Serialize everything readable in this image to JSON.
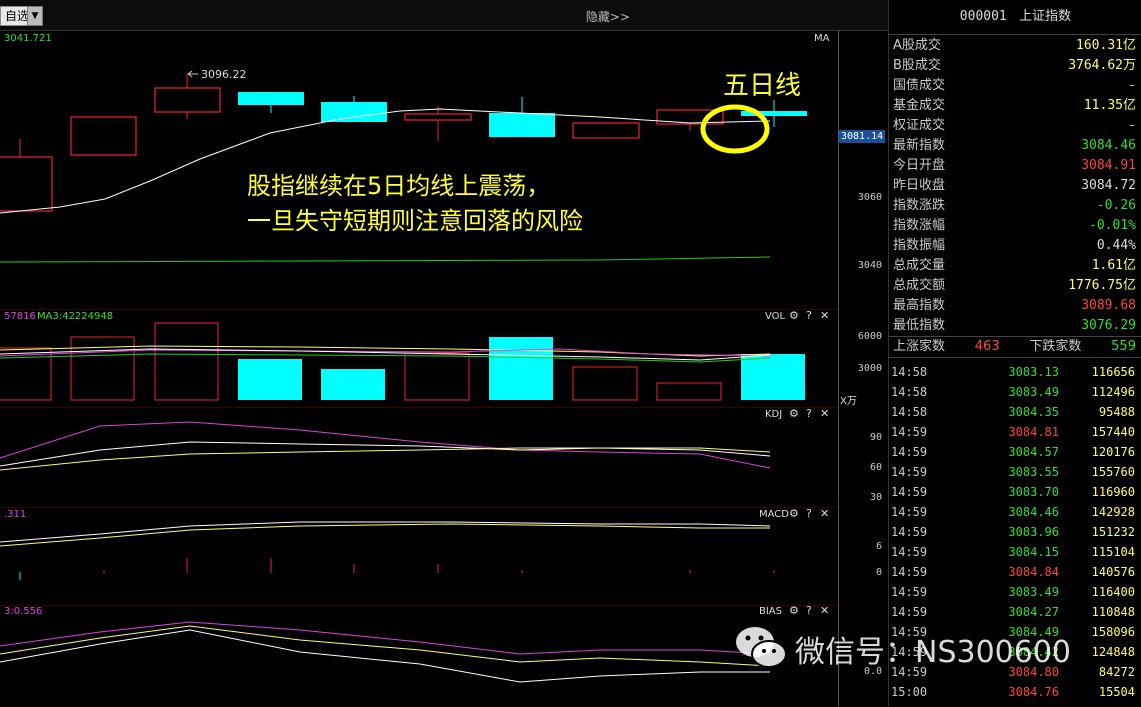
{
  "topbar": {
    "zixuan": "自选",
    "hide_label": "隐藏",
    "hide_icon": "double-chevron-right-icon"
  },
  "main_chart": {
    "top_left_value": "3041.721",
    "ma_label": "MA",
    "peak_label": "3096.22",
    "price_box": "3081.14",
    "axis_ticks": [
      "3060",
      "3040"
    ],
    "annotation_line1": "股指继续在5日均线上震荡，",
    "annotation_line2": "一旦失守短期则注意回落的风险",
    "five_day_label": "五日线"
  },
  "vol_panel": {
    "left_label": "57816",
    "ma3_label": "MA3:42224948",
    "title": "VOL",
    "ticks": [
      "6000",
      "3000"
    ],
    "unit": "X万"
  },
  "kdj_panel": {
    "title": "KDJ",
    "ticks": [
      "90",
      "60",
      "30"
    ]
  },
  "macd_panel": {
    "left_label": ".311",
    "title": "MACD",
    "ticks": [
      "6",
      "0"
    ]
  },
  "bias_panel": {
    "left_label": "3:0.556",
    "title": "BIAS",
    "ticks": [
      "0.0"
    ]
  },
  "right_panel": {
    "code": "000001",
    "name": "上证指数",
    "stats": [
      {
        "label": "A股成交",
        "value": "160.31亿",
        "color": "yellow"
      },
      {
        "label": "B股成交",
        "value": "3764.62万",
        "color": "yellow"
      },
      {
        "label": "国债成交",
        "value": "-",
        "color": "white"
      },
      {
        "label": "基金成交",
        "value": "11.35亿",
        "color": "yellow"
      },
      {
        "label": "权证成交",
        "value": "-",
        "color": "white"
      },
      {
        "label": "最新指数",
        "value": "3084.46",
        "color": "green"
      },
      {
        "label": "今日开盘",
        "value": "3084.91",
        "color": "red"
      },
      {
        "label": "昨日收盘",
        "value": "3084.72",
        "color": "white"
      },
      {
        "label": "指数涨跌",
        "value": "-0.26",
        "color": "green"
      },
      {
        "label": "指数涨幅",
        "value": "-0.01%",
        "color": "green"
      },
      {
        "label": "指数振幅",
        "value": "0.44%",
        "color": "white"
      },
      {
        "label": "总成交量",
        "value": "1.61亿",
        "color": "yellow"
      },
      {
        "label": "总成交额",
        "value": "1776.75亿",
        "color": "yellow"
      },
      {
        "label": "最高指数",
        "value": "3089.68",
        "color": "red"
      },
      {
        "label": "最低指数",
        "value": "3076.29",
        "color": "green"
      }
    ],
    "up_label": "上涨家数",
    "up_value": "463",
    "down_label": "下跌家数",
    "down_value": "559",
    "ticks": [
      {
        "t": "14:58",
        "p": "3083.13",
        "c": "green",
        "v": "116656"
      },
      {
        "t": "14:58",
        "p": "3083.49",
        "c": "green",
        "v": "112496"
      },
      {
        "t": "14:58",
        "p": "3084.35",
        "c": "green",
        "v": "95488"
      },
      {
        "t": "14:59",
        "p": "3084.81",
        "c": "red",
        "v": "157440"
      },
      {
        "t": "14:59",
        "p": "3084.57",
        "c": "green",
        "v": "120176"
      },
      {
        "t": "14:59",
        "p": "3083.55",
        "c": "green",
        "v": "155760"
      },
      {
        "t": "14:59",
        "p": "3083.70",
        "c": "green",
        "v": "116960"
      },
      {
        "t": "14:59",
        "p": "3084.46",
        "c": "green",
        "v": "142928"
      },
      {
        "t": "14:59",
        "p": "3083.96",
        "c": "green",
        "v": "151232"
      },
      {
        "t": "14:59",
        "p": "3084.15",
        "c": "green",
        "v": "115104"
      },
      {
        "t": "14:59",
        "p": "3084.84",
        "c": "red",
        "v": "140576"
      },
      {
        "t": "14:59",
        "p": "3083.49",
        "c": "green",
        "v": "116400"
      },
      {
        "t": "14:59",
        "p": "3084.27",
        "c": "green",
        "v": "110848"
      },
      {
        "t": "14:59",
        "p": "3084.49",
        "c": "green",
        "v": "158096"
      },
      {
        "t": "14:59",
        "p": "3084.42",
        "c": "green",
        "v": "124848"
      },
      {
        "t": "14:59",
        "p": "3084.80",
        "c": "red",
        "v": "84272"
      },
      {
        "t": "15:00",
        "p": "3084.76",
        "c": "red",
        "v": "15504"
      }
    ]
  },
  "watermark": {
    "text": "微信号：NS300600",
    "icon": "wechat-icon"
  }
}
